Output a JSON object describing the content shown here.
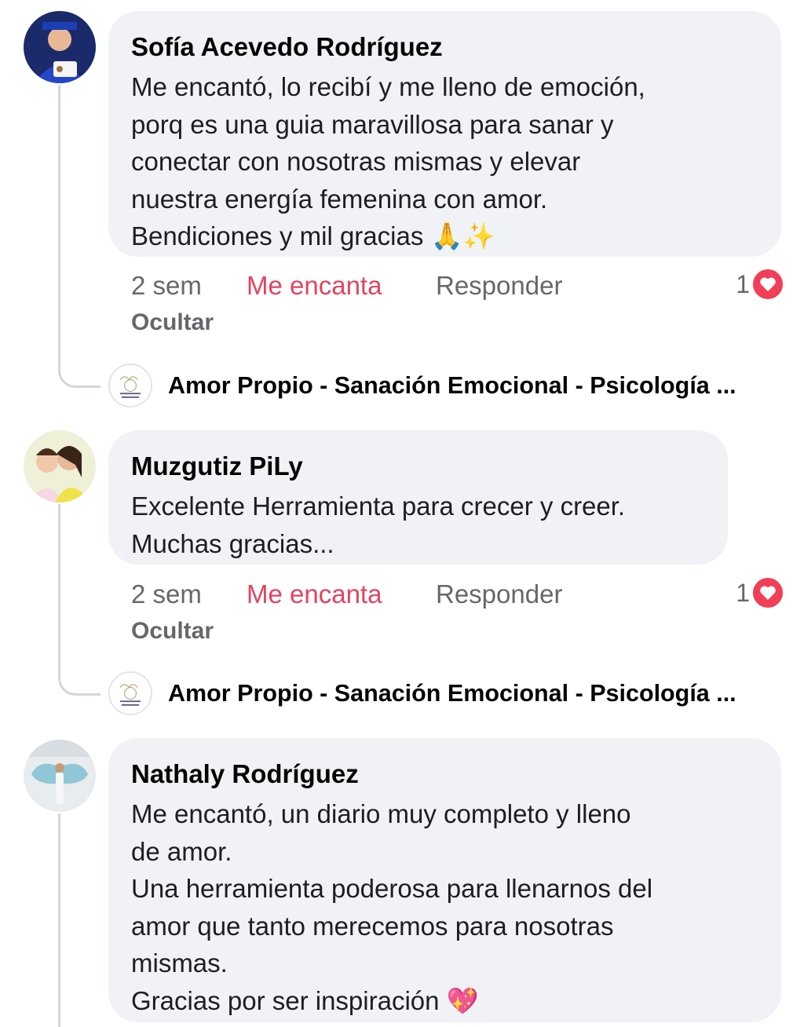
{
  "comments": [
    {
      "author": "Sofía Acevedo Rodríguez",
      "text": "Me encantó, lo recibí y me lleno de emoción,\nporq es una guia maravillosa para sanar y\nconectar con nosotras mismas y elevar\nnuestra energía femenina con amor.\nBendiciones y mil gracias",
      "emoji": "🙏✨",
      "time": "2 sem",
      "love": "Me encanta",
      "reply": "Responder",
      "hide": "Ocultar",
      "reaction_count": "1",
      "reaction_icon": "heart-icon",
      "avatar_icon": "child-graduate-avatar"
    },
    {
      "author": "Muzgutiz PiLy",
      "text": "Excelente Herramienta para crecer y creer.\nMuchas gracias...",
      "emoji": "",
      "time": "2 sem",
      "love": "Me encanta",
      "reply": "Responder",
      "hide": "Ocultar",
      "reaction_count": "1",
      "reaction_icon": "heart-icon",
      "avatar_icon": "mother-daughter-avatar"
    },
    {
      "author": "Nathaly Rodríguez",
      "text": "Me encantó, un diario muy completo y lleno\nde amor.\nUna herramienta poderosa para llenarnos del\namor que tanto merecemos para nosotras\nmismas.\nGracias por ser inspiración",
      "emoji": "💖",
      "avatar_icon": "angel-wings-avatar"
    }
  ],
  "page_reply": {
    "name": "Amor Propio - Sanación Emocional - Psicología ...",
    "avatar_icon": "page-logo-avatar"
  },
  "colors": {
    "bubble": "#f0f2f5",
    "love_text": "#e4435f",
    "meta_text": "#65676b",
    "heart": "#f33e58"
  }
}
